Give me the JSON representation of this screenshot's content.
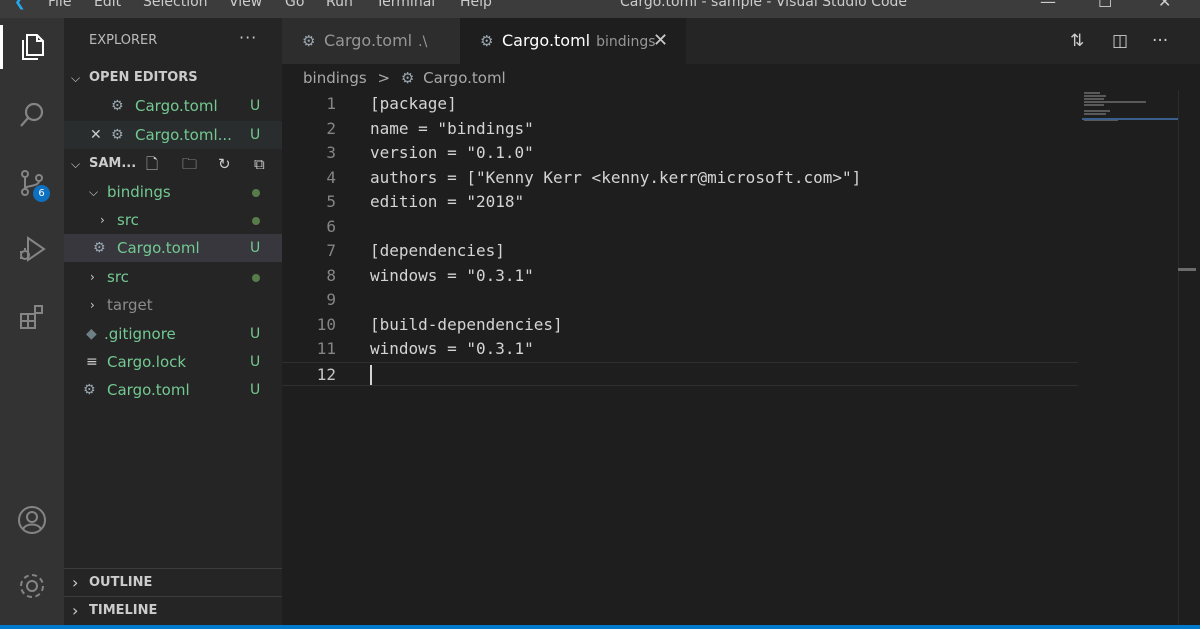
{
  "window": {
    "menu": [
      "File",
      "Edit",
      "Selection",
      "View",
      "Go",
      "Run",
      "Terminal",
      "Help"
    ],
    "title": "Cargo.toml - sample - Visual Studio Code"
  },
  "activity_bar": {
    "items": [
      {
        "name": "explorer-icon",
        "active": true
      },
      {
        "name": "search-icon"
      },
      {
        "name": "source-control-icon",
        "badge": "6"
      },
      {
        "name": "run-debug-icon"
      },
      {
        "name": "extensions-icon"
      },
      {
        "name": "accounts-icon"
      },
      {
        "name": "manage-gear-icon"
      }
    ]
  },
  "sidebar": {
    "title": "EXPLORER",
    "more": "···",
    "open_editors": {
      "header": "OPEN EDITORS",
      "items": [
        {
          "label": "Cargo.toml",
          "status": "U"
        },
        {
          "label": "Cargo.toml...",
          "status": "U",
          "close": "✕"
        }
      ]
    },
    "workspace": {
      "header": "SAM...",
      "tree": [
        {
          "label": "bindings",
          "type": "folder"
        },
        {
          "label": "src",
          "type": "folder"
        },
        {
          "label": "Cargo.toml",
          "type": "file",
          "status": "U"
        },
        {
          "label": "src",
          "type": "folder"
        },
        {
          "label": "target",
          "type": "folder"
        },
        {
          "label": ".gitignore",
          "type": "file",
          "status": "U"
        },
        {
          "label": "Cargo.lock",
          "type": "file",
          "status": "U"
        },
        {
          "label": "Cargo.toml",
          "type": "file",
          "status": "U"
        }
      ]
    },
    "outline": "OUTLINE",
    "timeline": "TIMELINE"
  },
  "tabs": [
    {
      "label": "Cargo.toml",
      "description": ".\\",
      "active": false
    },
    {
      "label": "Cargo.toml",
      "description": "bindings",
      "active": true,
      "close": "✕"
    }
  ],
  "breadcrumb": {
    "folder": "bindings",
    "separator": ">",
    "file": "Cargo.toml"
  },
  "editor": {
    "lines": [
      {
        "n": "1",
        "text": "[package]"
      },
      {
        "n": "2",
        "text": "name = \"bindings\""
      },
      {
        "n": "3",
        "text": "version = \"0.1.0\""
      },
      {
        "n": "4",
        "text": "authors = [\"Kenny Kerr <kenny.kerr@microsoft.com>\"]"
      },
      {
        "n": "5",
        "text": "edition = \"2018\""
      },
      {
        "n": "6",
        "text": ""
      },
      {
        "n": "7",
        "text": "[dependencies]"
      },
      {
        "n": "8",
        "text": "windows = \"0.3.1\""
      },
      {
        "n": "9",
        "text": ""
      },
      {
        "n": "10",
        "text": "[build-dependencies]"
      },
      {
        "n": "11",
        "text": "windows = \"0.3.1\""
      },
      {
        "n": "12",
        "text": ""
      }
    ],
    "current_line": 12
  },
  "colors": {
    "accent": "#007acc",
    "untracked": "#73c991",
    "badge": "#0e70c0"
  }
}
